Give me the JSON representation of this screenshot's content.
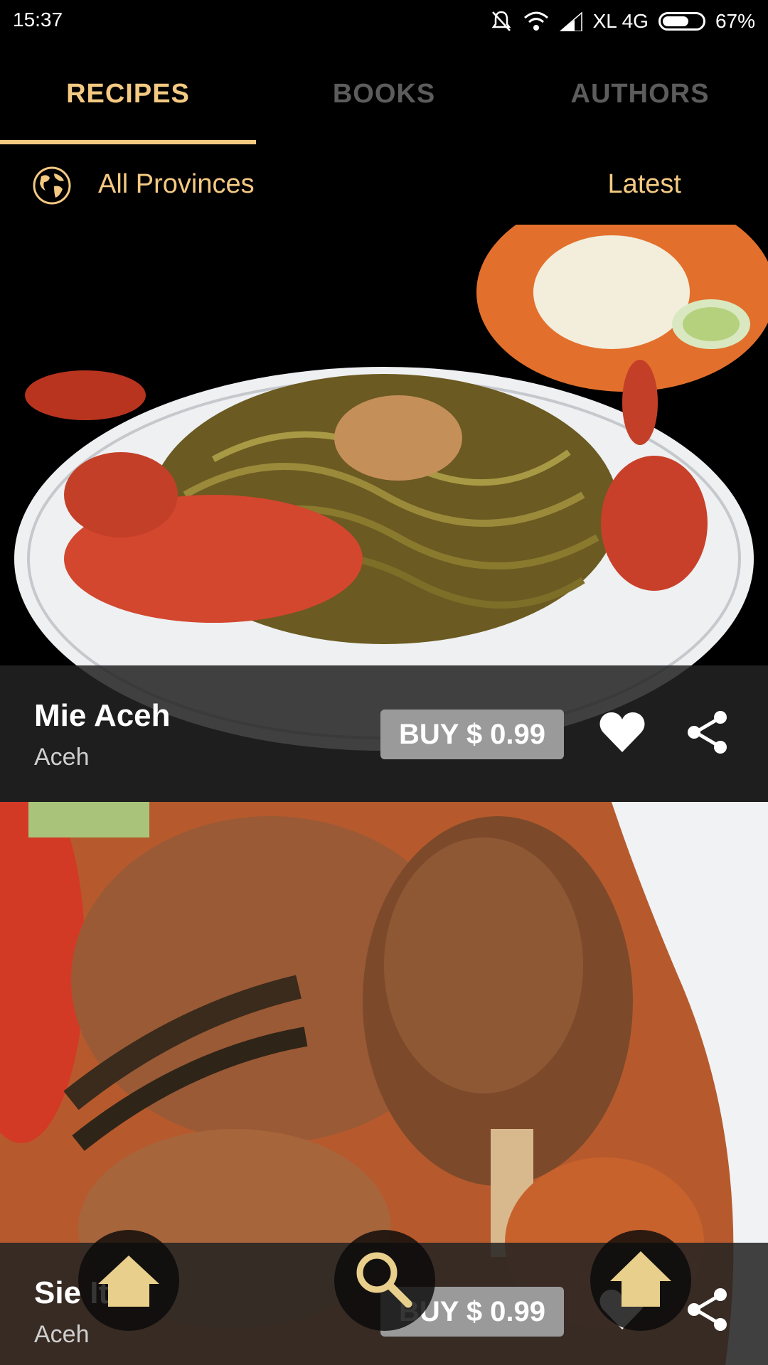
{
  "status_bar": {
    "time": "15:37",
    "carrier": "XL 4G",
    "battery_percent": "67%",
    "battery_level": 0.67
  },
  "tabs": [
    {
      "label": "RECIPES",
      "active": true
    },
    {
      "label": "BOOKS",
      "active": false
    },
    {
      "label": "AUTHORS",
      "active": false
    }
  ],
  "filter": {
    "province_label": "All Provinces",
    "sort_label": "Latest"
  },
  "recipes": [
    {
      "title": "Mie Aceh",
      "region": "Aceh",
      "buy_label": "BUY $ 0.99"
    },
    {
      "title": "Sie Itek",
      "region": "Aceh",
      "buy_label": "BUY $ 0.99"
    }
  ],
  "bottom_nav": [
    "home-icon",
    "search-icon",
    "upload-home-icon"
  ],
  "colors": {
    "accent": "#f4c982",
    "inactive_tab": "#5c5c5c",
    "background": "#000000"
  }
}
